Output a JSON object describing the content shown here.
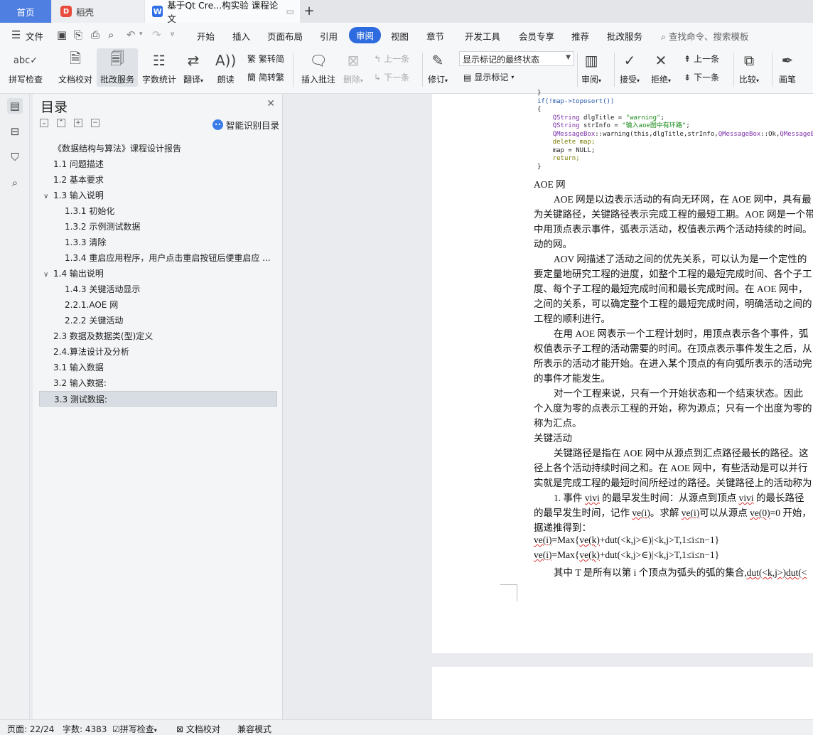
{
  "tabs": {
    "home": "首页",
    "daoke": "稻壳",
    "doc": "基于Qt Cre...构实验 课程论文"
  },
  "menu": {
    "file": "文件",
    "items": [
      "开始",
      "插入",
      "页面布局",
      "引用",
      "审阅",
      "视图",
      "章节",
      "开发工具",
      "会员专享",
      "推荐",
      "批改服务"
    ],
    "active": "审阅",
    "search": "查找命令、搜索模板"
  },
  "ribbon": {
    "spellcheck": "拼写检查",
    "doc_check": "文档校对",
    "correction_service": "批改服务",
    "word_count": "字数统计",
    "translate": "翻译",
    "read_aloud": "朗读",
    "to_simplified": "繁转简",
    "to_traditional": "简转繁",
    "insert_comment": "插入批注",
    "delete": "删除",
    "prev_comment": "上一条",
    "next_comment": "下一条",
    "revise": "修订",
    "markup_state": "显示标记的最终状态",
    "show_markup": "显示标记",
    "review": "审阅",
    "accept": "接受",
    "reject": "拒绝",
    "prev_change": "上一条",
    "next_change": "下一条",
    "compare": "比较",
    "pen": "画笔"
  },
  "toc": {
    "title": "目录",
    "smart": "智能识别目录",
    "items": [
      {
        "text": "《数据结构与算法》课程设计报告",
        "level": 0,
        "chevron": ""
      },
      {
        "text": "1.1  问题描述",
        "level": 1,
        "chevron": ""
      },
      {
        "text": "1.2  基本要求",
        "level": 1,
        "chevron": ""
      },
      {
        "text": "1.3  输入说明",
        "level": 1,
        "chevron": "∨"
      },
      {
        "text": "1.3.1  初始化",
        "level": 2,
        "chevron": ""
      },
      {
        "text": "1.3.2  示例测试数据",
        "level": 2,
        "chevron": ""
      },
      {
        "text": "1.3.3  清除",
        "level": 2,
        "chevron": ""
      },
      {
        "text": "1.3.4  重启应用程序，用户点击重启按钮后便重启应 ...",
        "level": 2,
        "chevron": ""
      },
      {
        "text": "1.4  输出说明",
        "level": 1,
        "chevron": "∨"
      },
      {
        "text": "1.4.3  关键活动显示",
        "level": 2,
        "chevron": ""
      },
      {
        "text": "2.2.1.AOE 网",
        "level": 2,
        "chevron": ""
      },
      {
        "text": "2.2.2  关键活动",
        "level": 2,
        "chevron": ""
      },
      {
        "text": "2.3  数据及数据类(型)定义",
        "level": 1,
        "chevron": ""
      },
      {
        "text": "2.4.算法设计及分析",
        "level": 1,
        "chevron": ""
      },
      {
        "text": "3.1  输入数据",
        "level": 1,
        "chevron": ""
      },
      {
        "text": "3.2  输入数据:",
        "level": 1,
        "chevron": ""
      },
      {
        "text": "3.3  测试数据:",
        "level": 1,
        "chevron": "",
        "selected": true
      }
    ]
  },
  "code": {
    "l1": "}",
    "l2": "if(!map->toposort())",
    "l3": "{",
    "l4a": "QString",
    "l4b": " dlgTitle = ",
    "l4c": "\"warning\"",
    "l4d": ";",
    "l5a": "QString",
    "l5b": " strInfo = ",
    "l5c": "\"输入aoe图中有环路\"",
    "l5d": ";",
    "l6a": "QMessageBox",
    "l6b": "::warning(this,dlgTitle,strInfo,",
    "l6c": "QMessageBox",
    "l6d": "::Ok,",
    "l6e": "QMessageBox",
    "l7": "delete map;",
    "l8": "map = NULL;",
    "l9": "return;",
    "l10": "}"
  },
  "doc": {
    "h_aoe": "AOE 网",
    "p1": "AOE 网是以边表示活动的有向无环网，在 AOE 网中，具有最",
    "p2": "为关键路径，关键路径表示完成工程的最短工期。AOE 网是一个带",
    "p3": "中用顶点表示事件，弧表示活动，权值表示两个活动持续的时间。",
    "p4": "动的网。",
    "p5": "AOV 网描述了活动之间的优先关系，可以认为是一个定性的",
    "p6": "要定量地研究工程的进度，如整个工程的最短完成时间、各个子工",
    "p7": "度、每个子工程的最短完成时间和最长完成时间。在 AOE 网中，",
    "p8": "之间的关系，可以确定整个工程的最短完成时间，明确活动之间的",
    "p9": "工程的顺利进行。",
    "p10": "在用 AOE 网表示一个工程计划时，用顶点表示各个事件，弧",
    "p11": "权值表示子工程的活动需要的时间。在顶点表示事件发生之后，从",
    "p12": "所表示的活动才能开始。在进入某个顶点的有向弧所表示的活动完",
    "p13": "的事件才能发生。",
    "p14": "对一个工程来说，只有一个开始状态和一个结束状态。因此",
    "p15": "个入度为零的点表示工程的开始，称为源点；只有一个出度为零的",
    "p16": "称为汇点。",
    "h_key": "关键活动",
    "p17": "关键路径是指在 AOE 网中从源点到汇点路径最长的路径。这",
    "p18": "径上各个活动持续时间之和。在 AOE 网中，有些活动是可以并行",
    "p19": "实就是完成工程的最短时间所经过的路径。关键路径上的活动称为",
    "p20a": "1. 事件 ",
    "p20b": "vivi",
    "p20c": " 的最早发生时间：从源点到顶点 ",
    "p20d": "vivi",
    "p20e": " 的最长路径",
    "p21a": "的最早发生时间，记作 ",
    "p21b": "ve(i)",
    "p21c": "。求解 ",
    "p21d": "ve(i)",
    "p21e": "可以从源点 ",
    "p21f": "ve(0)",
    "p21g": "=0 开始，",
    "p22": "据递推得到：",
    "f1a": "ve(i)",
    "f1b": "=Max{",
    "f1c": "ve(k)",
    "f1d": "+dut(<k,j>∈)|<k,j>T,1≤i≤n−1}",
    "f2a": "ve(i)",
    "f2b": "=Max{",
    "f2c": "ve(k)",
    "f2d": "+dut(<k,j>∈)|<k,j>T,1≤i≤n−1}",
    "p23a": "其中 T 是所有以第 i 个顶点为弧头的弧的集合,",
    "p23b": "dut(<k,j>)dut(<"
  },
  "status": {
    "page": "页面: 22/24",
    "words": "字数: 4383",
    "spellcheck": "拼写检查",
    "doccheck": "文档校对",
    "compat": "兼容模式"
  }
}
